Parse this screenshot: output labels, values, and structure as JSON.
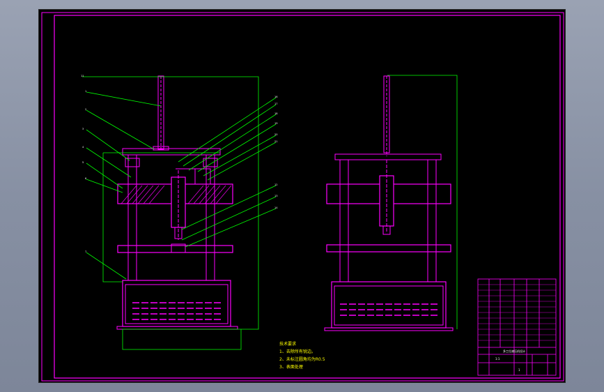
{
  "colors": {
    "viewport_bg": "#8a93a6",
    "sheet_bg": "#000000",
    "frame": "#ff00ff",
    "leader": "#00ff00",
    "body_part": "#ff00ff",
    "text_notes": "#ffff00",
    "dimension_text": "#ffffff"
  },
  "notes": {
    "title": "技术要求",
    "lines": [
      "1、去除所有锐边。",
      "2、未标注圆角均为R0.5",
      "3、表面处理"
    ]
  },
  "title_block": {
    "drawing_title": "多工位液压机设计",
    "scale": "1:1",
    "sheet": "1"
  }
}
